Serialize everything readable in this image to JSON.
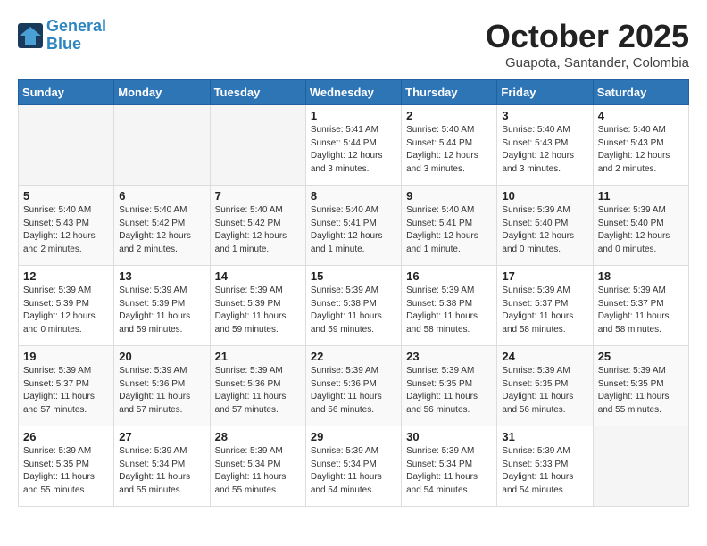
{
  "header": {
    "logo_line1": "General",
    "logo_line2": "Blue",
    "month_title": "October 2025",
    "location": "Guapota, Santander, Colombia"
  },
  "days_of_week": [
    "Sunday",
    "Monday",
    "Tuesday",
    "Wednesday",
    "Thursday",
    "Friday",
    "Saturday"
  ],
  "weeks": [
    [
      {
        "day": "",
        "info": ""
      },
      {
        "day": "",
        "info": ""
      },
      {
        "day": "",
        "info": ""
      },
      {
        "day": "1",
        "info": "Sunrise: 5:41 AM\nSunset: 5:44 PM\nDaylight: 12 hours\nand 3 minutes."
      },
      {
        "day": "2",
        "info": "Sunrise: 5:40 AM\nSunset: 5:44 PM\nDaylight: 12 hours\nand 3 minutes."
      },
      {
        "day": "3",
        "info": "Sunrise: 5:40 AM\nSunset: 5:43 PM\nDaylight: 12 hours\nand 3 minutes."
      },
      {
        "day": "4",
        "info": "Sunrise: 5:40 AM\nSunset: 5:43 PM\nDaylight: 12 hours\nand 2 minutes."
      }
    ],
    [
      {
        "day": "5",
        "info": "Sunrise: 5:40 AM\nSunset: 5:43 PM\nDaylight: 12 hours\nand 2 minutes."
      },
      {
        "day": "6",
        "info": "Sunrise: 5:40 AM\nSunset: 5:42 PM\nDaylight: 12 hours\nand 2 minutes."
      },
      {
        "day": "7",
        "info": "Sunrise: 5:40 AM\nSunset: 5:42 PM\nDaylight: 12 hours\nand 1 minute."
      },
      {
        "day": "8",
        "info": "Sunrise: 5:40 AM\nSunset: 5:41 PM\nDaylight: 12 hours\nand 1 minute."
      },
      {
        "day": "9",
        "info": "Sunrise: 5:40 AM\nSunset: 5:41 PM\nDaylight: 12 hours\nand 1 minute."
      },
      {
        "day": "10",
        "info": "Sunrise: 5:39 AM\nSunset: 5:40 PM\nDaylight: 12 hours\nand 0 minutes."
      },
      {
        "day": "11",
        "info": "Sunrise: 5:39 AM\nSunset: 5:40 PM\nDaylight: 12 hours\nand 0 minutes."
      }
    ],
    [
      {
        "day": "12",
        "info": "Sunrise: 5:39 AM\nSunset: 5:39 PM\nDaylight: 12 hours\nand 0 minutes."
      },
      {
        "day": "13",
        "info": "Sunrise: 5:39 AM\nSunset: 5:39 PM\nDaylight: 11 hours\nand 59 minutes."
      },
      {
        "day": "14",
        "info": "Sunrise: 5:39 AM\nSunset: 5:39 PM\nDaylight: 11 hours\nand 59 minutes."
      },
      {
        "day": "15",
        "info": "Sunrise: 5:39 AM\nSunset: 5:38 PM\nDaylight: 11 hours\nand 59 minutes."
      },
      {
        "day": "16",
        "info": "Sunrise: 5:39 AM\nSunset: 5:38 PM\nDaylight: 11 hours\nand 58 minutes."
      },
      {
        "day": "17",
        "info": "Sunrise: 5:39 AM\nSunset: 5:37 PM\nDaylight: 11 hours\nand 58 minutes."
      },
      {
        "day": "18",
        "info": "Sunrise: 5:39 AM\nSunset: 5:37 PM\nDaylight: 11 hours\nand 58 minutes."
      }
    ],
    [
      {
        "day": "19",
        "info": "Sunrise: 5:39 AM\nSunset: 5:37 PM\nDaylight: 11 hours\nand 57 minutes."
      },
      {
        "day": "20",
        "info": "Sunrise: 5:39 AM\nSunset: 5:36 PM\nDaylight: 11 hours\nand 57 minutes."
      },
      {
        "day": "21",
        "info": "Sunrise: 5:39 AM\nSunset: 5:36 PM\nDaylight: 11 hours\nand 57 minutes."
      },
      {
        "day": "22",
        "info": "Sunrise: 5:39 AM\nSunset: 5:36 PM\nDaylight: 11 hours\nand 56 minutes."
      },
      {
        "day": "23",
        "info": "Sunrise: 5:39 AM\nSunset: 5:35 PM\nDaylight: 11 hours\nand 56 minutes."
      },
      {
        "day": "24",
        "info": "Sunrise: 5:39 AM\nSunset: 5:35 PM\nDaylight: 11 hours\nand 56 minutes."
      },
      {
        "day": "25",
        "info": "Sunrise: 5:39 AM\nSunset: 5:35 PM\nDaylight: 11 hours\nand 55 minutes."
      }
    ],
    [
      {
        "day": "26",
        "info": "Sunrise: 5:39 AM\nSunset: 5:35 PM\nDaylight: 11 hours\nand 55 minutes."
      },
      {
        "day": "27",
        "info": "Sunrise: 5:39 AM\nSunset: 5:34 PM\nDaylight: 11 hours\nand 55 minutes."
      },
      {
        "day": "28",
        "info": "Sunrise: 5:39 AM\nSunset: 5:34 PM\nDaylight: 11 hours\nand 55 minutes."
      },
      {
        "day": "29",
        "info": "Sunrise: 5:39 AM\nSunset: 5:34 PM\nDaylight: 11 hours\nand 54 minutes."
      },
      {
        "day": "30",
        "info": "Sunrise: 5:39 AM\nSunset: 5:34 PM\nDaylight: 11 hours\nand 54 minutes."
      },
      {
        "day": "31",
        "info": "Sunrise: 5:39 AM\nSunset: 5:33 PM\nDaylight: 11 hours\nand 54 minutes."
      },
      {
        "day": "",
        "info": ""
      }
    ]
  ]
}
